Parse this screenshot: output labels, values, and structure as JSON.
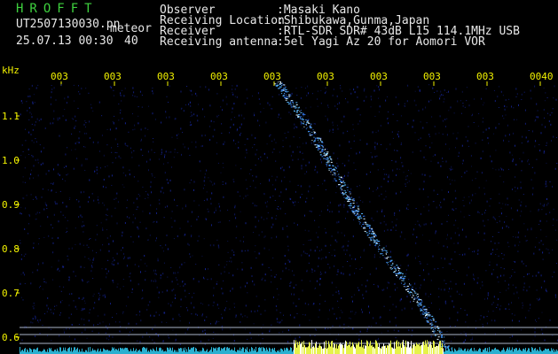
{
  "header": {
    "app_name": "HROFFT",
    "file_name": "UT2507130030.pn",
    "mode_label": "meteor",
    "datetime": "25.07.13 00:30",
    "count": "40",
    "info_labels": [
      "Observer",
      "Receiving Location",
      "Receiver",
      "Receiving antenna"
    ],
    "info_values": [
      ":Masaki Kano",
      ":Shibukawa,Gunma,Japan",
      ":RTL-SDR SDR# 43dB L15 114.1MHz USB",
      ":5el Yagi Az 20 for Aomori VOR"
    ]
  },
  "axes": {
    "y_unit": "kHz",
    "y_ticks": [
      "1.1",
      "1.0",
      "0.9",
      "0.8",
      "0.7",
      "0.6"
    ],
    "y_values": [
      1.1,
      1.0,
      0.9,
      0.8,
      0.7,
      0.6
    ],
    "x_ticks": [
      "003",
      "003",
      "003",
      "003",
      "003",
      "003",
      "003",
      "003",
      "003",
      "0040"
    ]
  },
  "colors": {
    "background": "#000000",
    "text": "#e8e8e8",
    "title": "#3ed13e",
    "axis": "#f2f200",
    "echo": "#4aa3ff",
    "baseline_noise": "#e6f24a",
    "reference_lines": "#aab4c8"
  }
}
